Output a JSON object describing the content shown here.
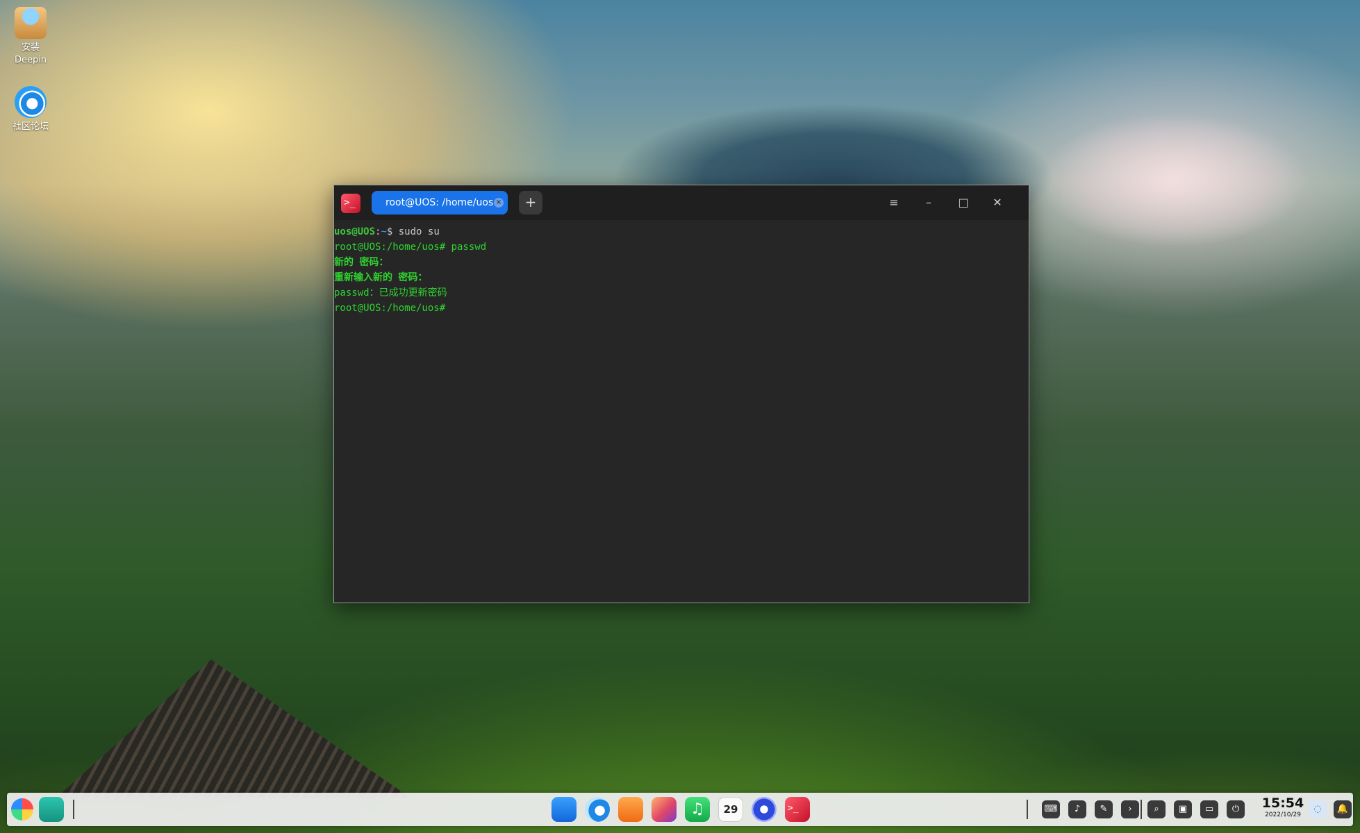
{
  "desktop": {
    "icons": [
      {
        "label_line1": "安装",
        "label_line2": "Deepin",
        "icon": "installer-icon"
      },
      {
        "label_line1": "社区论坛",
        "icon": "deepin-forum-icon"
      }
    ]
  },
  "terminal": {
    "tab_title": "root@UOS: /home/uos",
    "tab_close_glyph": "×",
    "new_tab_glyph": "+",
    "menu_glyph": "≡",
    "minimize_glyph": "–",
    "maximize_glyph": "□",
    "close_glyph": "✕",
    "lines": [
      {
        "user": "uos@UOS",
        "sep": ":",
        "path": "~",
        "prompt": "$ ",
        "cmd": "sudo su"
      },
      {
        "prompt_full": "root@UOS:/home/uos# ",
        "cmd": "passwd"
      },
      {
        "text": "新的 密码："
      },
      {
        "text": "重新输入新的 密码："
      },
      {
        "text": "passwd：已成功更新密码"
      },
      {
        "prompt_full": "root@UOS:/home/uos#"
      }
    ]
  },
  "dock": {
    "apps": [
      {
        "icon": "launcher-icon"
      },
      {
        "icon": "multitasking-icon"
      },
      {
        "icon": "file-manager-icon"
      },
      {
        "icon": "browser-icon"
      },
      {
        "icon": "app-store-icon"
      },
      {
        "icon": "photos-icon"
      },
      {
        "icon": "music-icon"
      },
      {
        "icon": "calendar-icon",
        "text": "29"
      },
      {
        "icon": "control-center-icon"
      },
      {
        "icon": "terminal-icon"
      }
    ],
    "tray": [
      {
        "icon": "keyboard-icon"
      },
      {
        "icon": "volume-icon"
      },
      {
        "icon": "pen-icon"
      },
      {
        "icon": "expand-arrow-icon"
      },
      {
        "icon": "search-icon"
      },
      {
        "icon": "screenshot-icon"
      },
      {
        "icon": "display-icon"
      },
      {
        "icon": "power-icon"
      }
    ],
    "clock_time": "15:54",
    "clock_date": "2022/10/29"
  }
}
